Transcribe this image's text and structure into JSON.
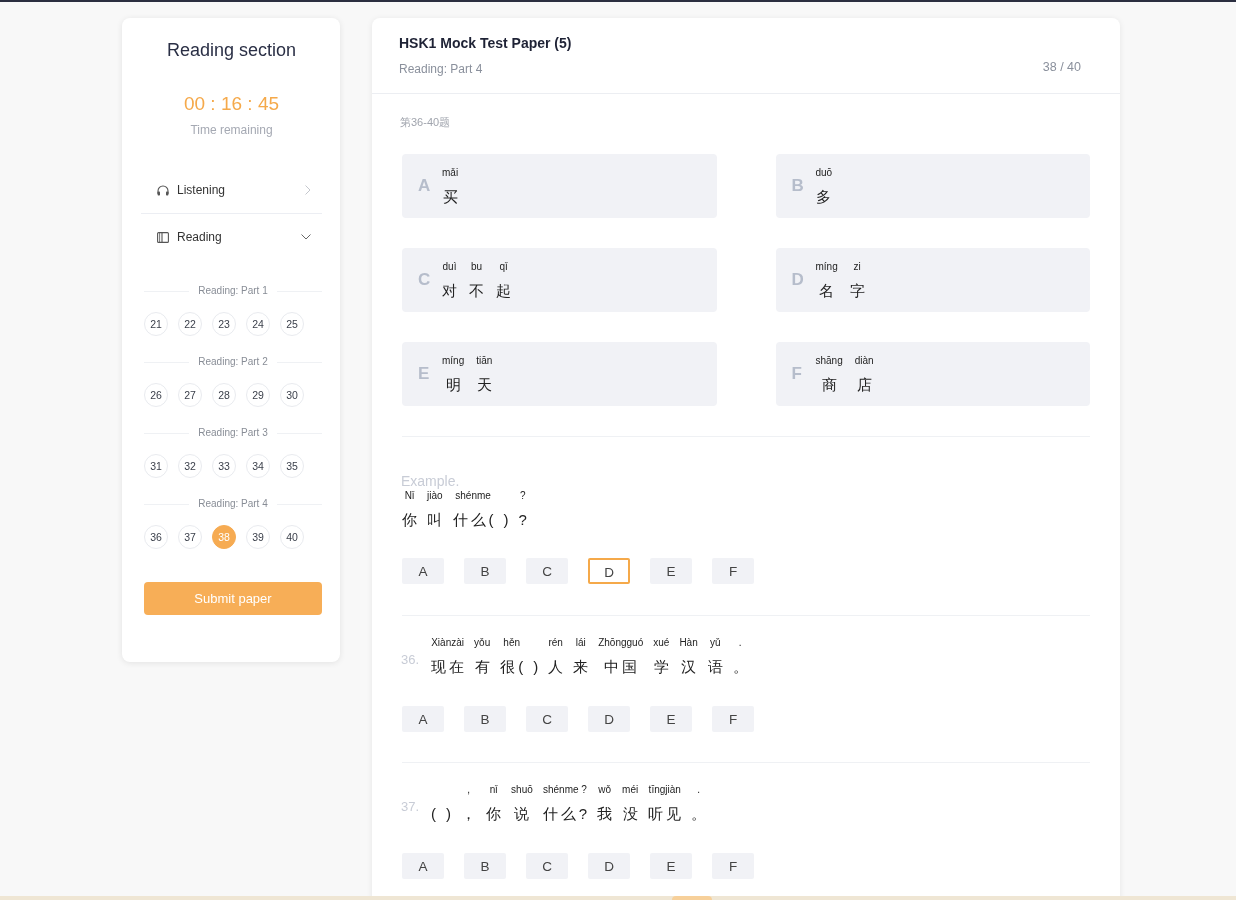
{
  "sidebar": {
    "title": "Reading section",
    "timer": "00 : 16 : 45",
    "timer_label": "Time remaining",
    "sections": [
      {
        "label": "Listening",
        "expanded": false
      },
      {
        "label": "Reading",
        "expanded": true,
        "groups": [
          {
            "title": "Reading: Part 1",
            "questions": [
              {
                "number": "21",
                "selected": false
              },
              {
                "number": "22",
                "selected": false
              },
              {
                "number": "23",
                "selected": false
              },
              {
                "number": "24",
                "selected": false
              },
              {
                "number": "25",
                "selected": false
              }
            ]
          },
          {
            "title": "Reading: Part 2",
            "questions": [
              {
                "number": "26",
                "selected": false
              },
              {
                "number": "27",
                "selected": false
              },
              {
                "number": "28",
                "selected": false
              },
              {
                "number": "29",
                "selected": false
              },
              {
                "number": "30",
                "selected": false
              }
            ]
          },
          {
            "title": "Reading: Part 3",
            "questions": [
              {
                "number": "31",
                "selected": false
              },
              {
                "number": "32",
                "selected": false
              },
              {
                "number": "33",
                "selected": false
              },
              {
                "number": "34",
                "selected": false
              },
              {
                "number": "35",
                "selected": false
              }
            ]
          },
          {
            "title": "Reading: Part 4",
            "questions": [
              {
                "number": "36",
                "selected": false
              },
              {
                "number": "37",
                "selected": false
              },
              {
                "number": "38",
                "selected": true
              },
              {
                "number": "39",
                "selected": false
              },
              {
                "number": "40",
                "selected": false
              }
            ]
          }
        ]
      }
    ],
    "submit": "Submit paper"
  },
  "paper": {
    "title": "HSK1 Mock Test Paper (5)",
    "subtitle": "Reading: Part 4",
    "progress": "38 / 40",
    "range": "第36-40题",
    "options": [
      {
        "letter": "A",
        "words": [
          {
            "pinyin": "mǎi",
            "hanzi": "买"
          }
        ]
      },
      {
        "letter": "B",
        "words": [
          {
            "pinyin": "duō",
            "hanzi": "多"
          }
        ]
      },
      {
        "letter": "C",
        "words": [
          {
            "pinyin": "duì",
            "hanzi": "对"
          },
          {
            "pinyin": "bu",
            "hanzi": "不"
          },
          {
            "pinyin": "qǐ",
            "hanzi": "起"
          }
        ]
      },
      {
        "letter": "D",
        "words": [
          {
            "pinyin": "míng",
            "hanzi": "名"
          },
          {
            "pinyin": "zi",
            "hanzi": "字"
          }
        ]
      },
      {
        "letter": "E",
        "words": [
          {
            "pinyin": "míng",
            "hanzi": "明"
          },
          {
            "pinyin": "tiān",
            "hanzi": "天"
          }
        ]
      },
      {
        "letter": "F",
        "words": [
          {
            "pinyin": "shāng",
            "hanzi": "商"
          },
          {
            "pinyin": "diàn",
            "hanzi": "店"
          }
        ]
      }
    ],
    "questions": [
      {
        "kind": "example",
        "label": "Example.",
        "words": [
          {
            "pinyin": "Nǐ",
            "hanzi": "你"
          },
          {
            "pinyin": "jiào",
            "hanzi": "叫"
          },
          {
            "pinyin": "shénme",
            "hanzi": "什么("
          },
          {
            "hanzi": ")"
          },
          {
            "pinyin": "?",
            "hanzi": "?"
          }
        ],
        "choices": [
          {
            "letter": "A",
            "selected": false
          },
          {
            "letter": "B",
            "selected": false
          },
          {
            "letter": "C",
            "selected": false
          },
          {
            "letter": "D",
            "selected": true
          },
          {
            "letter": "E",
            "selected": false
          },
          {
            "letter": "F",
            "selected": false
          }
        ]
      },
      {
        "kind": "numbered",
        "label": "36.",
        "words": [
          {
            "pinyin": "Xiànzài",
            "hanzi": "现在"
          },
          {
            "pinyin": "yǒu",
            "hanzi": "有"
          },
          {
            "pinyin": "hěn",
            "hanzi": "很("
          },
          {
            "hanzi": ")"
          },
          {
            "pinyin": "rén",
            "hanzi": "人"
          },
          {
            "pinyin": "lái",
            "hanzi": "来"
          },
          {
            "pinyin": "Zhōngguó",
            "hanzi": "中国"
          },
          {
            "pinyin": "xué",
            "hanzi": "学"
          },
          {
            "pinyin": "Hàn",
            "hanzi": "汉"
          },
          {
            "pinyin": "yǔ",
            "hanzi": "语"
          },
          {
            "pinyin": ".",
            "hanzi": "。"
          }
        ],
        "choices": [
          {
            "letter": "A",
            "selected": false
          },
          {
            "letter": "B",
            "selected": false
          },
          {
            "letter": "C",
            "selected": false
          },
          {
            "letter": "D",
            "selected": false
          },
          {
            "letter": "E",
            "selected": false
          },
          {
            "letter": "F",
            "selected": false
          }
        ]
      },
      {
        "kind": "numbered",
        "label": "37.",
        "words": [
          {
            "hanzi": "("
          },
          {
            "hanzi": ")"
          },
          {
            "pinyin": ",",
            "hanzi": "，"
          },
          {
            "pinyin": "nǐ",
            "hanzi": "你"
          },
          {
            "pinyin": "shuō",
            "hanzi": "说"
          },
          {
            "pinyin": "shénme ?",
            "hanzi": "什么?"
          },
          {
            "pinyin": "wǒ",
            "hanzi": "我"
          },
          {
            "pinyin": "méi",
            "hanzi": "没"
          },
          {
            "pinyin": "tīngjiàn",
            "hanzi": "听见"
          },
          {
            "pinyin": ".",
            "hanzi": "。"
          }
        ],
        "choices": [
          {
            "letter": "A",
            "selected": false
          },
          {
            "letter": "B",
            "selected": false
          },
          {
            "letter": "C",
            "selected": false
          },
          {
            "letter": "D",
            "selected": false
          },
          {
            "letter": "E",
            "selected": false
          },
          {
            "letter": "F",
            "selected": false
          }
        ]
      }
    ]
  }
}
